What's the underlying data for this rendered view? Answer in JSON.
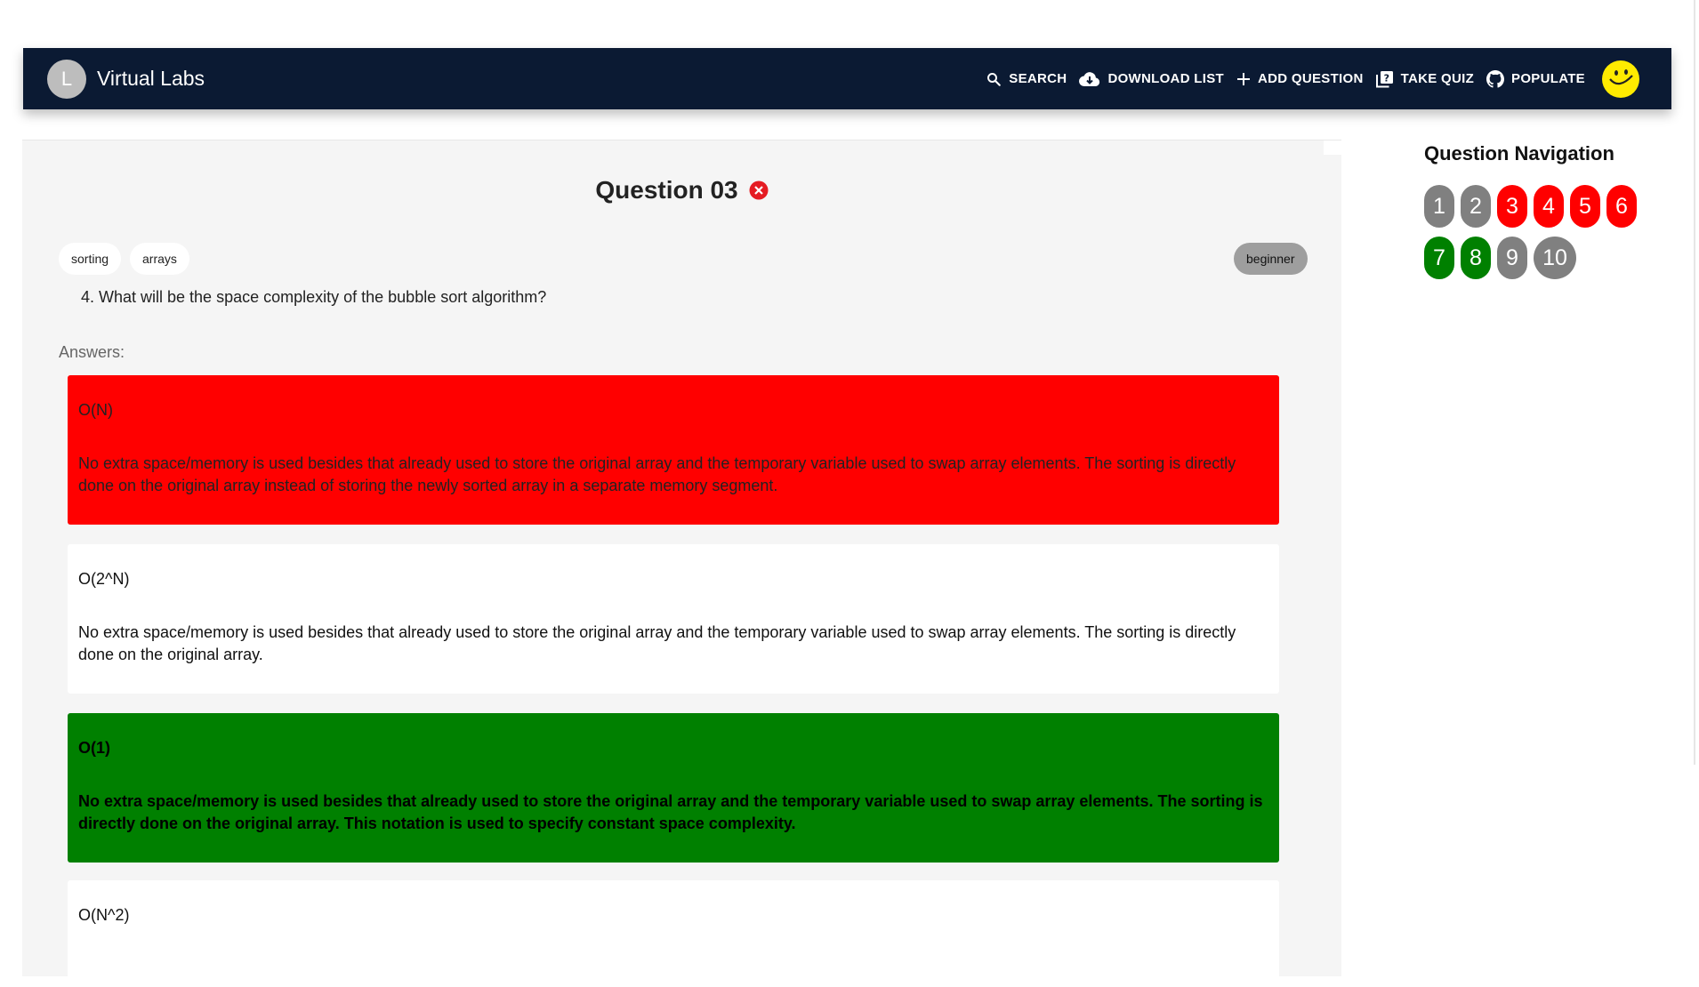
{
  "app": {
    "avatar_letter": "L",
    "title": "Virtual Labs"
  },
  "nav": {
    "search": "SEARCH",
    "download": "DOWNLOAD LIST",
    "add_question": "ADD QUESTION",
    "take_quiz": "TAKE QUIZ",
    "populate": "POPULATE"
  },
  "question": {
    "title": "Question 03",
    "tags": [
      "sorting",
      "arrays"
    ],
    "level": "beginner",
    "text": "4. What will be the space complexity of the bubble sort algorithm?",
    "answers_label": "Answers:"
  },
  "answers": [
    {
      "option": "O(N)",
      "explanation": "No extra space/memory is used besides that already used to store the original array and the temporary variable used to swap array elements. The sorting is directly done on the original array instead of storing the newly sorted array in a separate memory segment.",
      "state": "wrong"
    },
    {
      "option": "O(2^N)",
      "explanation": "No extra space/memory is used besides that already used to store the original array and the temporary variable used to swap array elements. The sorting is directly done on the original array.",
      "state": "neutral"
    },
    {
      "option": "O(1)",
      "explanation": "No extra space/memory is used besides that already used to store the original array and the temporary variable used to swap array elements. The sorting is directly done on the original array. This notation is used to specify constant space complexity.",
      "state": "correct"
    },
    {
      "option": "O(N^2)",
      "explanation": "",
      "state": "neutral"
    }
  ],
  "sidebar": {
    "title": "Question Navigation",
    "buttons": [
      {
        "label": "1",
        "status": "gray"
      },
      {
        "label": "2",
        "status": "gray"
      },
      {
        "label": "3",
        "status": "red"
      },
      {
        "label": "4",
        "status": "red"
      },
      {
        "label": "5",
        "status": "red"
      },
      {
        "label": "6",
        "status": "red"
      },
      {
        "label": "7",
        "status": "green"
      },
      {
        "label": "8",
        "status": "green"
      },
      {
        "label": "9",
        "status": "gray"
      },
      {
        "label": "10",
        "status": "gray"
      }
    ]
  },
  "colors": {
    "appbar": "#0b1a33",
    "wrong": "#ff0000",
    "correct": "#008000",
    "unanswered": "#808080",
    "smiley": "#ffeb00"
  }
}
